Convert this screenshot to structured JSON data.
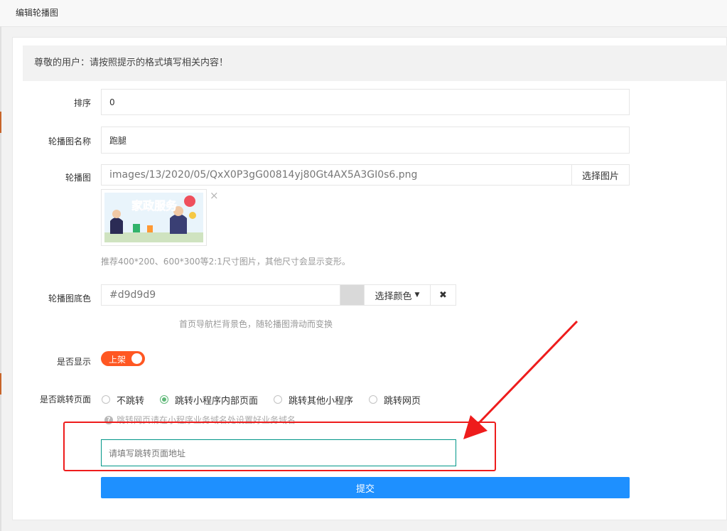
{
  "window": {
    "title": "编辑轮播图"
  },
  "notice": {
    "text": "尊敬的用户：请按照提示的格式填写相关内容！"
  },
  "form": {
    "sort": {
      "label": "排序",
      "value": "0"
    },
    "name": {
      "label": "轮播图名称",
      "value": "跑腿"
    },
    "image": {
      "label": "轮播图",
      "path": "images/13/2020/05/QxX0P3gG00814yj80Gt4AX5A3GI0s6.png",
      "choose_label": "选择图片",
      "remove_glyph": "×",
      "hint": "推荐400*200、600*300等2:1尺寸图片，其他尺寸会显示变形。",
      "thumb_text": "家政服务"
    },
    "bg_color": {
      "label": "轮播图底色",
      "value": "#d9d9d9",
      "swatch_color": "#d9d9d9",
      "choose_label": "选择颜色",
      "clear_glyph": "✖",
      "hint": "首页导航栏背景色，随轮播图滑动而变换"
    },
    "display": {
      "label": "是否显示",
      "switch_label": "上架",
      "on": true
    },
    "jump": {
      "label": "是否跳转页面",
      "options": [
        {
          "label": "不跳转",
          "checked": false
        },
        {
          "label": "跳转小程序内部页面",
          "checked": true
        },
        {
          "label": "跳转其他小程序",
          "checked": false
        },
        {
          "label": "跳转网页",
          "checked": false
        }
      ],
      "help_glyph": "?",
      "help": "跳转网页请在小程序业务域名处设置好业务域名",
      "url_placeholder": "请填写跳转页面地址"
    },
    "submit_label": "提交"
  },
  "colors": {
    "accent_switch": "#ff5722",
    "radio_checked": "#5fb878",
    "submit": "#1e90ff",
    "annotation": "#ee1c1c"
  }
}
